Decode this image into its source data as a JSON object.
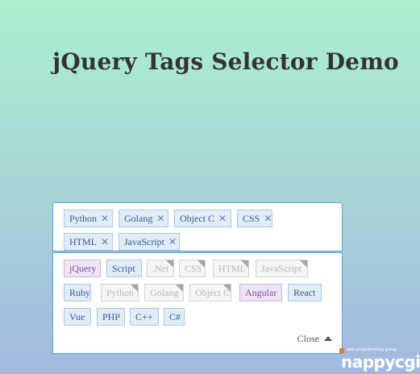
{
  "page": {
    "title": "jQuery Tags Selector Demo"
  },
  "selected_tags": [
    {
      "label": "Python"
    },
    {
      "label": "Golang"
    },
    {
      "label": "Object C"
    },
    {
      "label": "CSS"
    },
    {
      "label": "HTML"
    },
    {
      "label": "JavaScript"
    }
  ],
  "remove_glyph": "✕",
  "options": [
    {
      "label": "jQuery",
      "state": "active"
    },
    {
      "label": "Script",
      "state": "normal"
    },
    {
      "label": ".Net",
      "state": "disabled"
    },
    {
      "label": "CSS",
      "state": "disabled"
    },
    {
      "label": "HTML",
      "state": "disabled"
    },
    {
      "label": "JavaScript",
      "state": "disabled"
    },
    {
      "label": "Ruby",
      "state": "normal"
    },
    {
      "label": "Python",
      "state": "disabled"
    },
    {
      "label": "Golang",
      "state": "disabled"
    },
    {
      "label": "Object C",
      "state": "disabled"
    },
    {
      "label": "Angular",
      "state": "active"
    },
    {
      "label": "React",
      "state": "normal"
    },
    {
      "label": "Vue",
      "state": "normal"
    },
    {
      "label": "PHP",
      "state": "normal"
    },
    {
      "label": "C++",
      "state": "normal"
    },
    {
      "label": "C#",
      "state": "normal"
    }
  ],
  "dropdown": {
    "close_label": "Close"
  },
  "watermark": {
    "small_text": "web programming group",
    "brand": "nappycgi"
  },
  "colors": {
    "tag_bg": "#e2ecf7",
    "tag_border": "#a9c7e8",
    "tag_text": "#2c5e93",
    "active_text": "#7a4fa3",
    "disabled_text": "#b6b6b6",
    "border_accent": "#5d9fd8"
  }
}
